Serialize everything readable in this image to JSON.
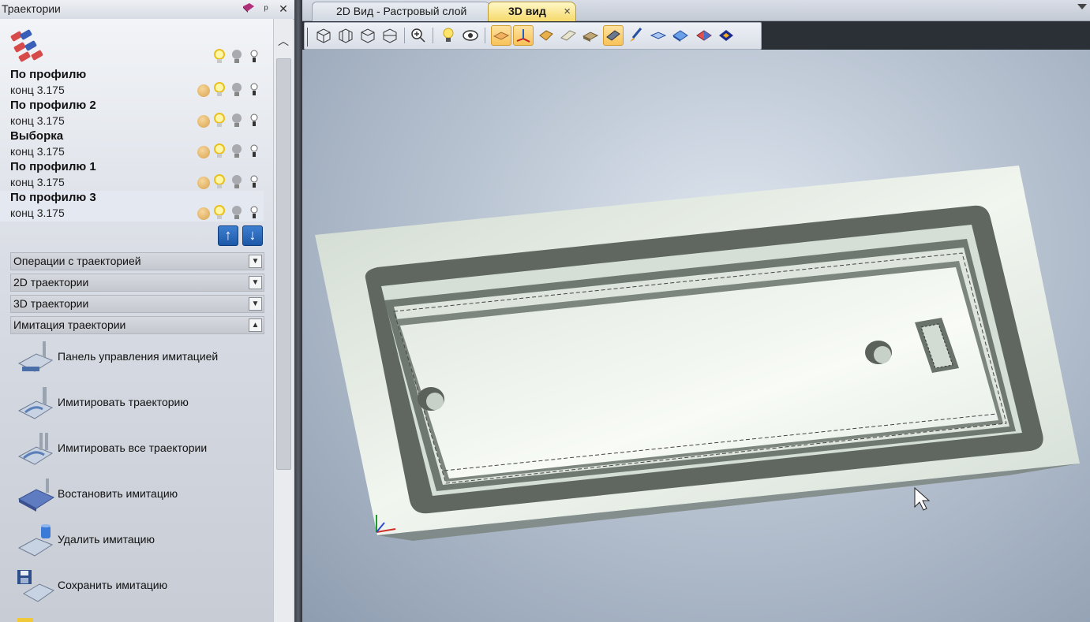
{
  "panel": {
    "title": "Траектории",
    "pin_icon": "pin-icon",
    "close_icon": "close-icon",
    "group_icon": "toolpaths-group-icon"
  },
  "trajectories": [
    {
      "name": "По профилю",
      "tool": "конц 3.175",
      "selected": false
    },
    {
      "name": "По профилю 2",
      "tool": "конц 3.175",
      "selected": false
    },
    {
      "name": "Выборка",
      "tool": "конц 3.175",
      "selected": false
    },
    {
      "name": "По профилю 1",
      "tool": "конц 3.175",
      "selected": false
    },
    {
      "name": "По профилю 3",
      "tool": "конц 3.175",
      "selected": true
    }
  ],
  "reorder": {
    "up_icon": "arrow-up-icon",
    "down_icon": "arrow-down-icon"
  },
  "sections": [
    {
      "label": "Операции с траекторией",
      "expanded": false
    },
    {
      "label": "2D траектории",
      "expanded": false
    },
    {
      "label": "3D траектории",
      "expanded": false
    },
    {
      "label": "Имитация траектории",
      "expanded": true
    }
  ],
  "commands": [
    {
      "label": "Панель управления имитацией",
      "icon": "simulation-panel-icon"
    },
    {
      "label": "Имитировать траекторию",
      "icon": "simulate-toolpath-icon"
    },
    {
      "label": "Имитировать все траектории",
      "icon": "simulate-all-icon"
    },
    {
      "label": "Востановить имитацию",
      "icon": "restore-simulation-icon"
    },
    {
      "label": "Удалить имитацию",
      "icon": "delete-simulation-icon"
    },
    {
      "label": "Сохранить имитацию",
      "icon": "save-simulation-icon"
    }
  ],
  "tabs": [
    {
      "label": "2D Вид - Растровый слой",
      "active": false
    },
    {
      "label": "3D вид",
      "active": true,
      "close": "×"
    }
  ],
  "toolbar": [
    {
      "icon": "iso-view-icon"
    },
    {
      "icon": "front-view-icon"
    },
    {
      "icon": "top-view-icon"
    },
    {
      "icon": "side-view-icon"
    },
    {
      "icon": "zoom-fit-icon"
    },
    {
      "icon": "light-icon"
    },
    {
      "icon": "eye-view-icon"
    },
    {
      "icon": "show-material-icon",
      "active": true
    },
    {
      "icon": "show-axes-icon",
      "active": true
    },
    {
      "icon": "show-model-icon"
    },
    {
      "icon": "show-toolpath-icon"
    },
    {
      "icon": "show-relief-icon"
    },
    {
      "icon": "show-layer-icon",
      "active": true
    },
    {
      "icon": "paint-icon"
    },
    {
      "icon": "plane-icon"
    },
    {
      "icon": "render-icon"
    },
    {
      "icon": "shaded-icon"
    },
    {
      "icon": "wireframe-icon"
    }
  ],
  "colors": {
    "accent_tab": "#f6d96a",
    "arrow_button": "#1d58a8",
    "material": "#e8efe6"
  }
}
